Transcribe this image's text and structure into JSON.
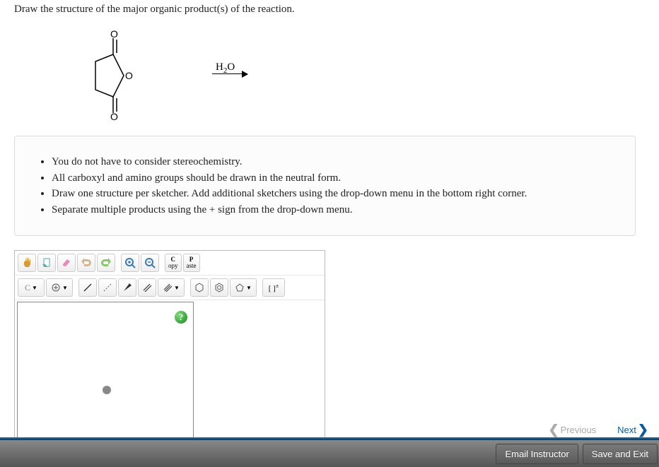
{
  "question": "Draw the structure of the major organic product(s) of the reaction.",
  "reagent_html": "H₂O",
  "instructions": [
    "You do not have to consider stereochemistry.",
    "All carboxyl and amino groups should be drawn in the neutral form.",
    "Draw one structure per sketcher. Add additional sketchers using the drop-down menu in the bottom right corner.",
    "Separate multiple products using the + sign from the drop-down menu."
  ],
  "toolbar": {
    "copy": "C",
    "copy_sub": "opy",
    "paste": "P",
    "paste_sub": "aste",
    "element": "C",
    "bracket": "[ ]"
  },
  "nav": {
    "previous": "Previous",
    "next": "Next"
  },
  "footer": {
    "email": "Email Instructor",
    "save": "Save and Exit"
  }
}
